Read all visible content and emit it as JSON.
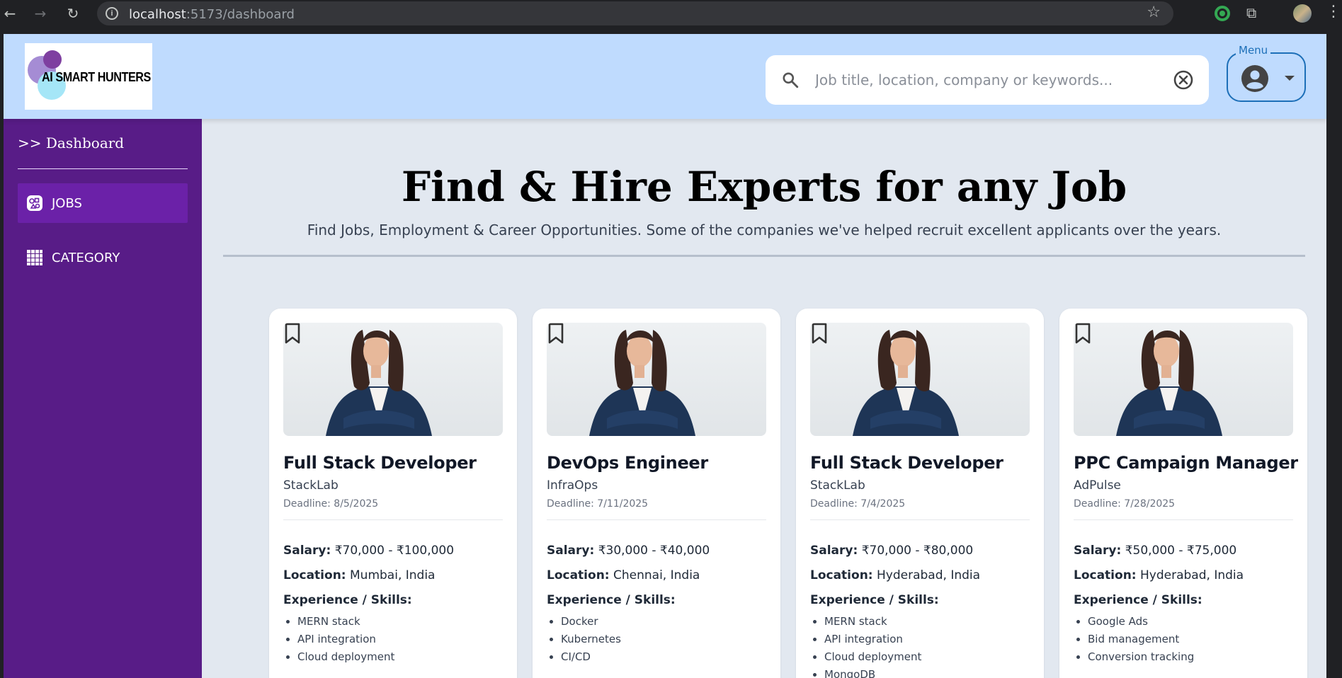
{
  "browser": {
    "url_host": "localhost",
    "url_rest": ":5173/dashboard"
  },
  "header": {
    "logo_text": "AI SMART HUNTERS",
    "search_placeholder": "Job title, location, company or keywords...",
    "menu_label": "Menu"
  },
  "sidebar": {
    "dashboard_link": ">> Dashboard",
    "items": [
      {
        "label": "JOBS",
        "active": true
      },
      {
        "label": "CATEGORY",
        "active": false
      }
    ]
  },
  "hero": {
    "title": "Find & Hire Experts for any Job",
    "subtitle": "Find Jobs, Employment & Career Opportunities. Some of the companies we've helped recruit excellent applicants over the years."
  },
  "labels": {
    "salary": "Salary:",
    "location": "Location:",
    "skills": "Experience / Skills:"
  },
  "jobs": [
    {
      "title": "Full Stack Developer",
      "company": "StackLab",
      "deadline": "Deadline: 8/5/2025",
      "salary": "₹70,000 - ₹100,000",
      "location": "Mumbai, India",
      "skills": [
        "MERN stack",
        "API integration",
        "Cloud deployment"
      ]
    },
    {
      "title": "DevOps Engineer",
      "company": "InfraOps",
      "deadline": "Deadline: 7/11/2025",
      "salary": "₹30,000 - ₹40,000",
      "location": "Chennai, India",
      "skills": [
        "Docker",
        "Kubernetes",
        "CI/CD"
      ]
    },
    {
      "title": "Full Stack Developer",
      "company": "StackLab",
      "deadline": "Deadline: 7/4/2025",
      "salary": "₹70,000 - ₹80,000",
      "location": "Hyderabad, India",
      "skills": [
        "MERN stack",
        "API integration",
        "Cloud deployment",
        "MongoDB"
      ]
    },
    {
      "title": "PPC Campaign Manager",
      "company": "AdPulse",
      "deadline": "Deadline: 7/28/2025",
      "salary": "₹50,000 - ₹75,000",
      "location": "Hyderabad, India",
      "skills": [
        "Google Ads",
        "Bid management",
        "Conversion tracking"
      ]
    }
  ],
  "colors": {
    "header_bg": "#bfdbfe",
    "sidebar_bg": "#581c87",
    "sidebar_active": "#6b21a8",
    "page_bg": "#e2e8f0",
    "menu_accent": "#1d6fb8"
  }
}
